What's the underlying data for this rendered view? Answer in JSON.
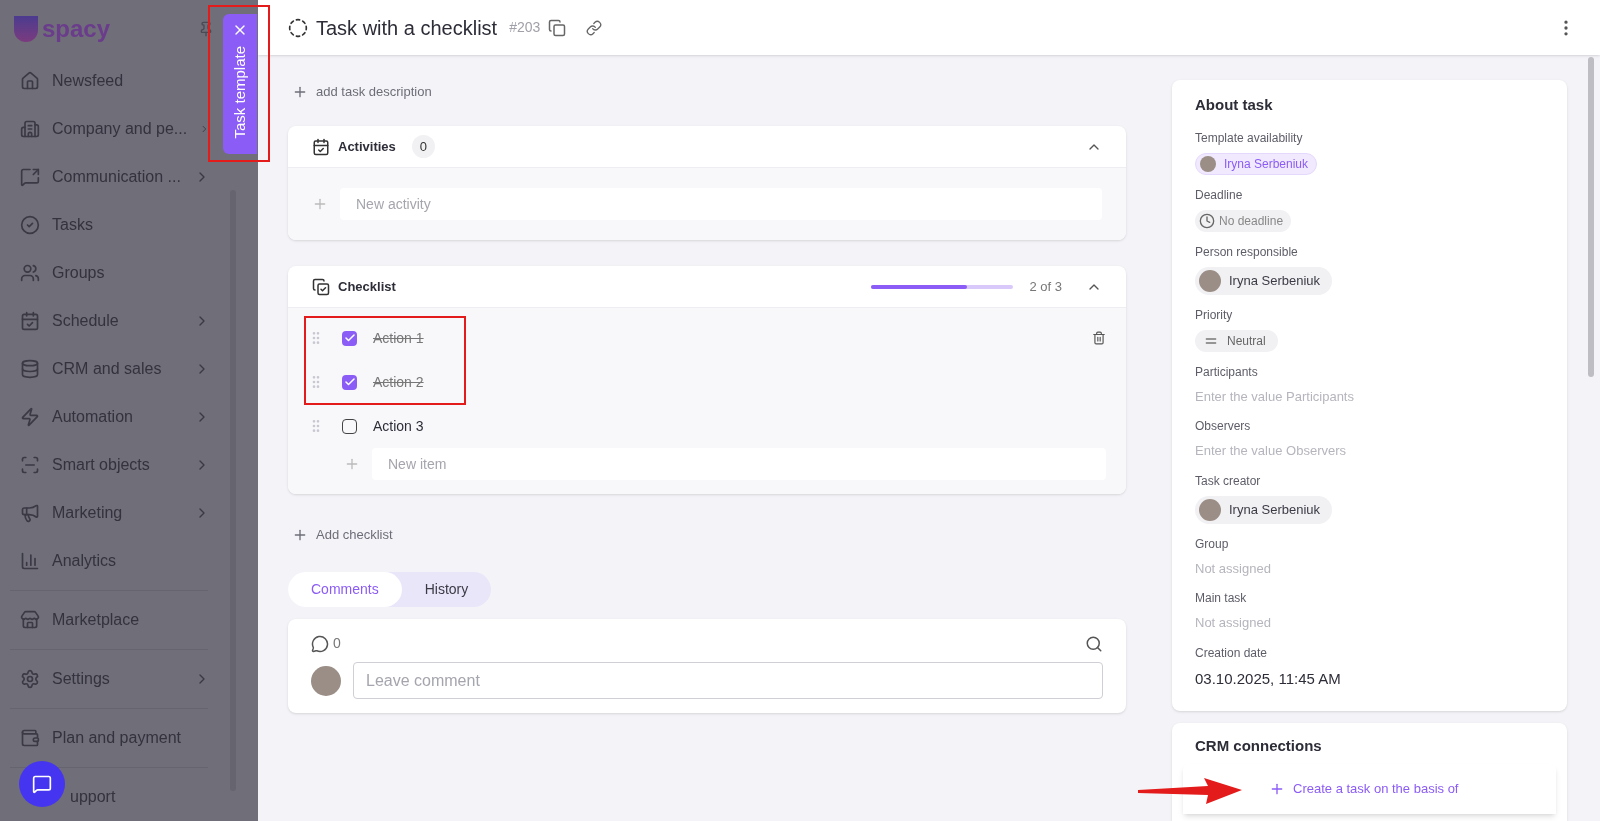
{
  "sidebar": {
    "logo": "spacy",
    "items": [
      {
        "label": "Newsfeed",
        "expandable": false
      },
      {
        "label": "Company and pe...",
        "expandable": true
      },
      {
        "label": "Communication ...",
        "expandable": true
      },
      {
        "label": "Tasks",
        "expandable": false
      },
      {
        "label": "Groups",
        "expandable": false
      },
      {
        "label": "Schedule",
        "expandable": true
      },
      {
        "label": "CRM and sales",
        "expandable": true
      },
      {
        "label": "Automation",
        "expandable": true
      },
      {
        "label": "Smart objects",
        "expandable": true
      },
      {
        "label": "Marketing",
        "expandable": true
      },
      {
        "label": "Analytics",
        "expandable": false
      },
      {
        "label": "Marketplace",
        "expandable": false
      },
      {
        "label": "Settings",
        "expandable": true
      },
      {
        "label": "Plan and payment",
        "expandable": false
      },
      {
        "label": "upport",
        "expandable": false
      }
    ]
  },
  "side_tab": {
    "label": "Task template"
  },
  "header": {
    "title": "Task with a checklist",
    "number": "#203"
  },
  "add_description": "add task description",
  "activities": {
    "title": "Activities",
    "count": "0",
    "input_placeholder": "New activity"
  },
  "checklist": {
    "title": "Checklist",
    "level": 0.67,
    "progress": "2 of 3",
    "items": [
      {
        "label": "Action 1",
        "checked": true
      },
      {
        "label": "Action 2",
        "checked": true
      },
      {
        "label": "Action 3",
        "checked": false
      }
    ],
    "input_placeholder": "New item"
  },
  "add_checklist": "Add checklist",
  "tabs": [
    {
      "label": "Comments",
      "selected": true
    },
    {
      "label": "History",
      "selected": false
    }
  ],
  "comments": {
    "count": "0",
    "placeholder": "Leave comment"
  },
  "about": {
    "title": "About task",
    "fields": [
      {
        "label": "Template availability",
        "kind": "user-accent",
        "value": "Iryna Serbeniuk"
      },
      {
        "label": "Deadline",
        "kind": "deadline",
        "value": "No deadline"
      },
      {
        "label": "Person responsible",
        "kind": "user",
        "value": "Iryna Serbeniuk"
      },
      {
        "label": "Priority",
        "kind": "priority",
        "value": "Neutral"
      },
      {
        "label": "Participants",
        "kind": "empty",
        "placeholder": "Enter the value Participants"
      },
      {
        "label": "Observers",
        "kind": "empty",
        "placeholder": "Enter the value Observers"
      },
      {
        "label": "Task creator",
        "kind": "user",
        "value": "Iryna Serbeniuk"
      },
      {
        "label": "Group",
        "kind": "empty",
        "placeholder": "Not assigned"
      },
      {
        "label": "Main task",
        "kind": "empty",
        "placeholder": "Not assigned"
      },
      {
        "label": "Creation date",
        "kind": "text",
        "value": "03.10.2025, 11:45 AM"
      }
    ]
  },
  "crm": {
    "title": "CRM connections",
    "action": "Create a task on the basis of"
  }
}
